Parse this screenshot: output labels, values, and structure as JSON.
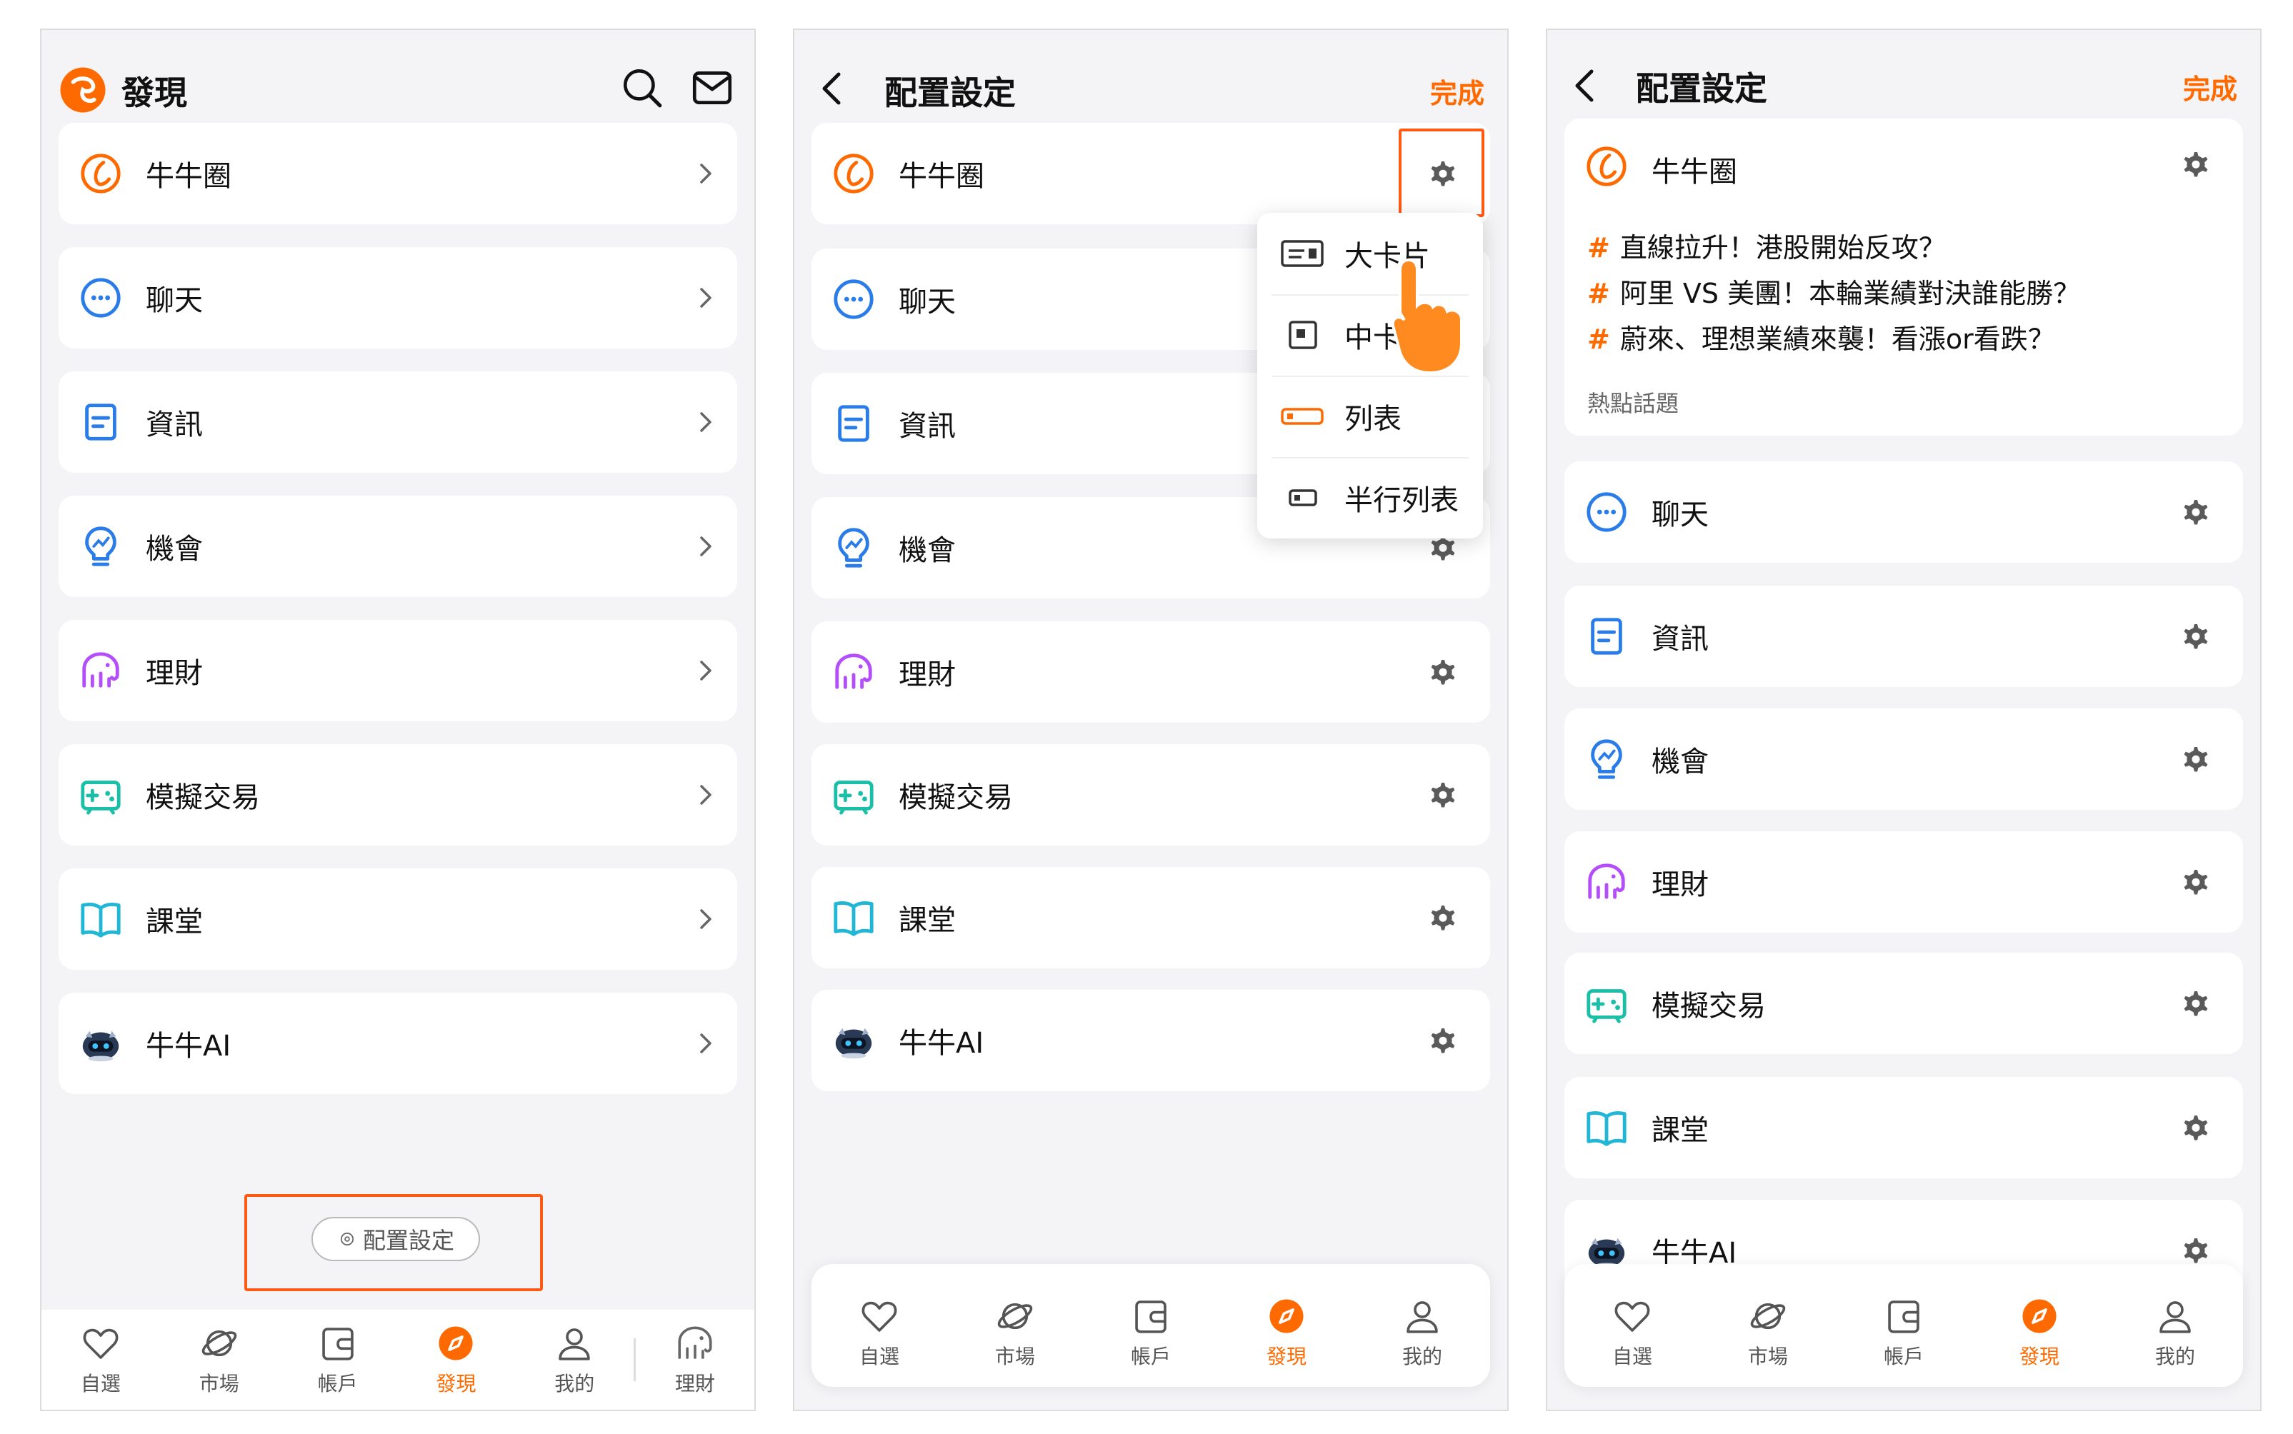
{
  "colors": {
    "accent": "#ff6a00",
    "blue": "#2a7ce8",
    "purple": "#b44dfa",
    "teal": "#1bbfa8",
    "cyan": "#20b7d6"
  },
  "panel1": {
    "title": "發現",
    "search_icon": "search-icon",
    "mail_icon": "mail-icon",
    "items": [
      {
        "label": "牛牛圈",
        "icon": "niuniu-circle-icon"
      },
      {
        "label": "聊天",
        "icon": "chat-icon"
      },
      {
        "label": "資訊",
        "icon": "news-icon"
      },
      {
        "label": "機會",
        "icon": "bulb-icon"
      },
      {
        "label": "理財",
        "icon": "elephant-icon"
      },
      {
        "label": "模擬交易",
        "icon": "gamepad-icon"
      },
      {
        "label": "課堂",
        "icon": "book-icon"
      },
      {
        "label": "牛牛AI",
        "icon": "robot-icon"
      }
    ],
    "config_button": "配置設定",
    "tabs": [
      "自選",
      "市場",
      "帳戶",
      "發現",
      "我的",
      "理財"
    ]
  },
  "panel2": {
    "title": "配置設定",
    "done": "完成",
    "items": [
      "牛牛圈",
      "聊天",
      "資訊",
      "機會",
      "理財",
      "模擬交易",
      "課堂",
      "牛牛AI"
    ],
    "dropdown": [
      "大卡片",
      "中卡片",
      "列表",
      "半行列表"
    ],
    "tabs": [
      "自選",
      "市場",
      "帳戶",
      "發現",
      "我的"
    ]
  },
  "panel3": {
    "title": "配置設定",
    "done": "完成",
    "big_card": {
      "label": "牛牛圈",
      "topics": [
        "直線拉升！港股開始反攻？",
        "阿里 VS 美團！本輪業績對決誰能勝？",
        "蔚來、理想業績來襲！看漲or看跌？"
      ],
      "hashtag": "#",
      "footer": "熱點話題"
    },
    "items": [
      "聊天",
      "資訊",
      "機會",
      "理財",
      "模擬交易",
      "課堂",
      "牛牛AI"
    ],
    "tabs": [
      "自選",
      "市場",
      "帳戶",
      "發現",
      "我的"
    ]
  }
}
